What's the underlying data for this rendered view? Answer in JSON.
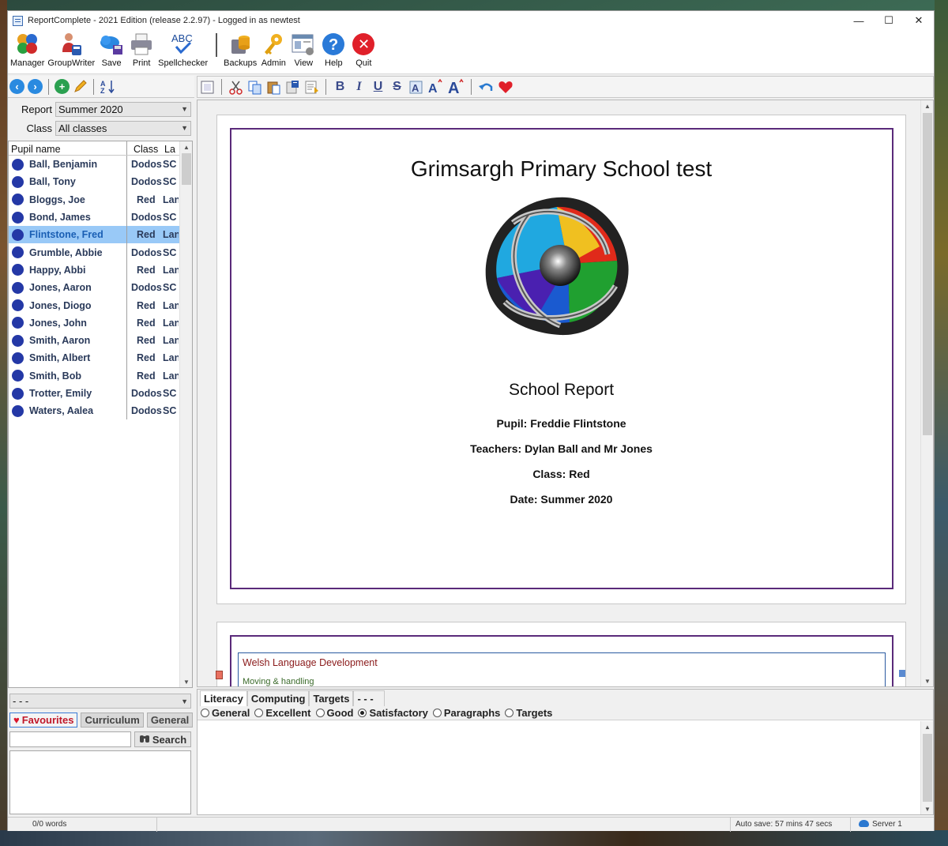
{
  "window": {
    "title": "ReportComplete - 2021 Edition (release 2.2.97) - Logged in as newtest",
    "minimize": "—",
    "maximize": "☐",
    "close": "✕"
  },
  "ribbon": {
    "buttons": [
      {
        "label": "Manager",
        "icon": "manager-icon"
      },
      {
        "label": "GroupWriter",
        "icon": "groupwriter-icon"
      },
      {
        "label": "Save",
        "icon": "save-icon"
      },
      {
        "label": "Print",
        "icon": "print-icon"
      },
      {
        "label": "Spellchecker",
        "icon": "spellchecker-icon",
        "text": "ABC"
      },
      {
        "label": "Backups",
        "icon": "backups-icon"
      },
      {
        "label": "Admin",
        "icon": "admin-key-icon"
      },
      {
        "label": "View",
        "icon": "view-icon"
      },
      {
        "label": "Help",
        "icon": "help-icon",
        "text": "?"
      },
      {
        "label": "Quit",
        "icon": "quit-icon",
        "text": "✕"
      }
    ]
  },
  "filters": {
    "report_label": "Report",
    "report_value": "Summer 2020",
    "class_label": "Class",
    "class_value": "All classes"
  },
  "pupil_table": {
    "headers": {
      "name": "Pupil name",
      "class": "Class",
      "third": "La"
    },
    "rows": [
      {
        "name": "Ball, Benjamin",
        "class": "Dodos",
        "third": "SC"
      },
      {
        "name": "Ball, Tony",
        "class": "Dodos",
        "third": "SC"
      },
      {
        "name": "Bloggs, Joe",
        "class": "Red",
        "third": "Lan"
      },
      {
        "name": "Bond, James",
        "class": "Dodos",
        "third": "SC"
      },
      {
        "name": "Flintstone, Fred",
        "class": "Red",
        "third": "Lan",
        "selected": true
      },
      {
        "name": "Grumble, Abbie",
        "class": "Dodos",
        "third": "SC"
      },
      {
        "name": "Happy, Abbi",
        "class": "Red",
        "third": "Lan"
      },
      {
        "name": "Jones, Aaron",
        "class": "Dodos",
        "third": "SC"
      },
      {
        "name": "Jones, Diogo",
        "class": "Red",
        "third": "Lan"
      },
      {
        "name": "Jones, John",
        "class": "Red",
        "third": "Lan"
      },
      {
        "name": "Smith, Aaron",
        "class": "Red",
        "third": "Lan"
      },
      {
        "name": "Smith, Albert",
        "class": "Red",
        "third": "Lan"
      },
      {
        "name": "Smith, Bob",
        "class": "Red",
        "third": "Lan"
      },
      {
        "name": "Trotter, Emily",
        "class": "Dodos",
        "third": "SC"
      },
      {
        "name": "Waters, Aalea",
        "class": "Dodos",
        "third": "SC"
      }
    ]
  },
  "comment_bank": {
    "category_value": "- - -",
    "tabs": [
      "Favourites",
      "Curriculum",
      "General"
    ],
    "search_label": "Search",
    "search_value": ""
  },
  "document": {
    "school_name": "Grimsargh Primary School test",
    "heading": "School Report",
    "pupil_line": "Pupil: Freddie Flintstone",
    "teachers_line": "Teachers: Dylan Ball and Mr Jones",
    "class_line": "Class: Red",
    "date_line": "Date: Summer 2020",
    "section_title": "Welsh Language Development",
    "section_sub": "Moving & handling"
  },
  "editor": {
    "tabs": [
      "Literacy",
      "Computing",
      "Targets",
      "- - -"
    ],
    "radios": [
      {
        "label": "General",
        "checked": false
      },
      {
        "label": "Excellent",
        "checked": false
      },
      {
        "label": "Good",
        "checked": false
      },
      {
        "label": "Satisfactory",
        "checked": true
      },
      {
        "label": "Paragraphs",
        "checked": false
      },
      {
        "label": "Targets",
        "checked": false
      }
    ]
  },
  "status": {
    "words": "0/0 words",
    "autosave": "Auto save: 57 mins 47 secs",
    "server": "Server 1"
  },
  "colors": {
    "selection": "#99c9f7",
    "pupil_dot": "#2438a6",
    "frame": "#5a2a7a",
    "favourite": "#d9142b"
  }
}
